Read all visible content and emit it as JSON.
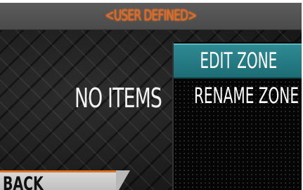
{
  "header": {
    "title": "<USER DEFINED>"
  },
  "content": {
    "empty_text": "NO ITEMS"
  },
  "footer": {
    "back_label": "BACK"
  },
  "menu": {
    "items": [
      {
        "label": "EDIT ZONE",
        "selected": true
      },
      {
        "label": "RENAME ZONE",
        "selected": false
      }
    ]
  },
  "colors": {
    "accent": "#e06a1f",
    "highlight": "#2a7f88",
    "background": "#1c1c1c"
  }
}
